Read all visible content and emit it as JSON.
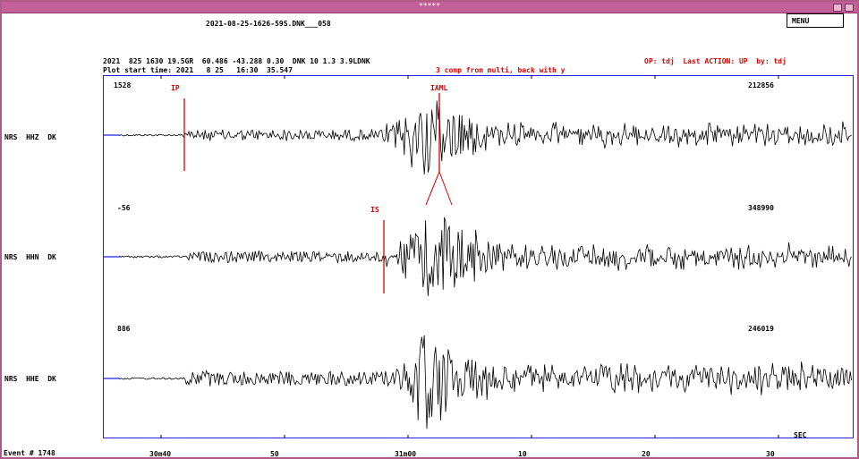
{
  "window": {
    "title": "*****"
  },
  "header": {
    "file_name": "2021-08-25-1626-59S.DNK___058",
    "event_line": "2021  825 1630 19.5GR  60.486 -43.288 0.30  DNK 10 1.3 3.9LDNK",
    "plot_start": "Plot start time: 2021   8 25   16:30  35.547",
    "mode_msg": "3 comp from multi, back with y",
    "operator": "OP: tdj  Last ACTION: UP  by: tdj"
  },
  "menu": {
    "label": "MENU"
  },
  "channels": [
    {
      "station": "NRS",
      "component": "HHZ",
      "network": "DK",
      "min": "1528",
      "max": "212856"
    },
    {
      "station": "NRS",
      "component": "HHN",
      "network": "DK",
      "min": "-56",
      "max": "348990"
    },
    {
      "station": "NRS",
      "component": "HHE",
      "network": "DK",
      "min": "886",
      "max": "246019"
    }
  ],
  "picks": [
    {
      "label": "IP",
      "channel": 0
    },
    {
      "label": "IAML",
      "channel": 0
    },
    {
      "label": "IS",
      "channel": 1
    }
  ],
  "time_axis": {
    "unit_label": "SEC",
    "ticks": [
      "30m40",
      "50",
      "31m00",
      "10",
      "20",
      "30"
    ]
  },
  "footer": {
    "event_label": "Event # 1748"
  },
  "colors": {
    "trace": "#000000",
    "pick": "#e00000",
    "frame": "#2020e0",
    "title_bar": "#c3609a"
  }
}
